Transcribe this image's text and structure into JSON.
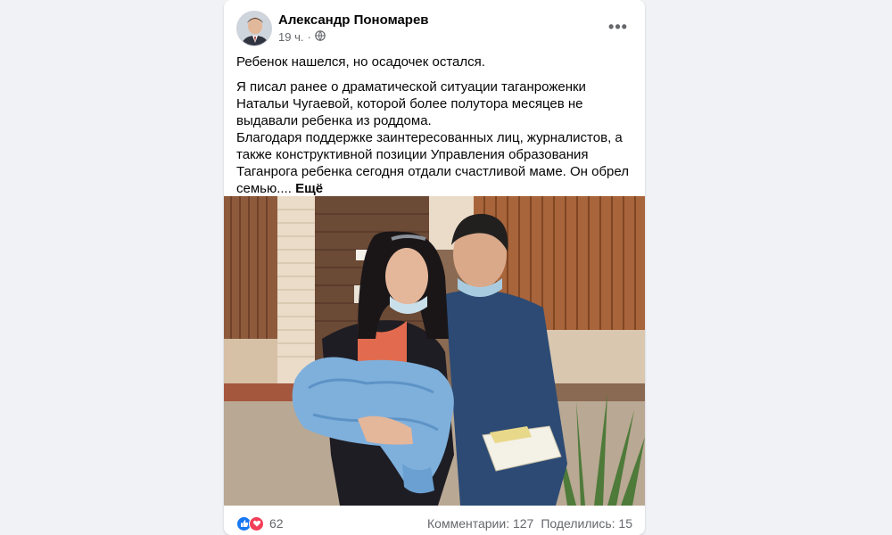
{
  "post": {
    "author": "Александр Пономарев",
    "time": "19 ч.",
    "audience_icon": "globe-icon",
    "more_icon": "•••",
    "lead": "Ребенок нашелся, но осадочек остался.",
    "body_line1": "Я писал ранее о драматической ситуации таганроженки Натальи Чугаевой, которой более полутора месяцев не выдавали ребенка из роддома.",
    "body_line2": "Благодаря поддержке заинтересованных лиц, журналистов, а также конструктивной позиции Управления образования Таганрога ребенка сегодня отдали счастливой маме. Он обрел семью....",
    "see_more": "Ещё"
  },
  "footer": {
    "reactions_count": "62",
    "comments": "Комментарии: 127",
    "shares": "Поделились: 15"
  },
  "colors": {
    "like": "#1877f2",
    "love": "#f33e58",
    "secondary_text": "#65676b"
  }
}
